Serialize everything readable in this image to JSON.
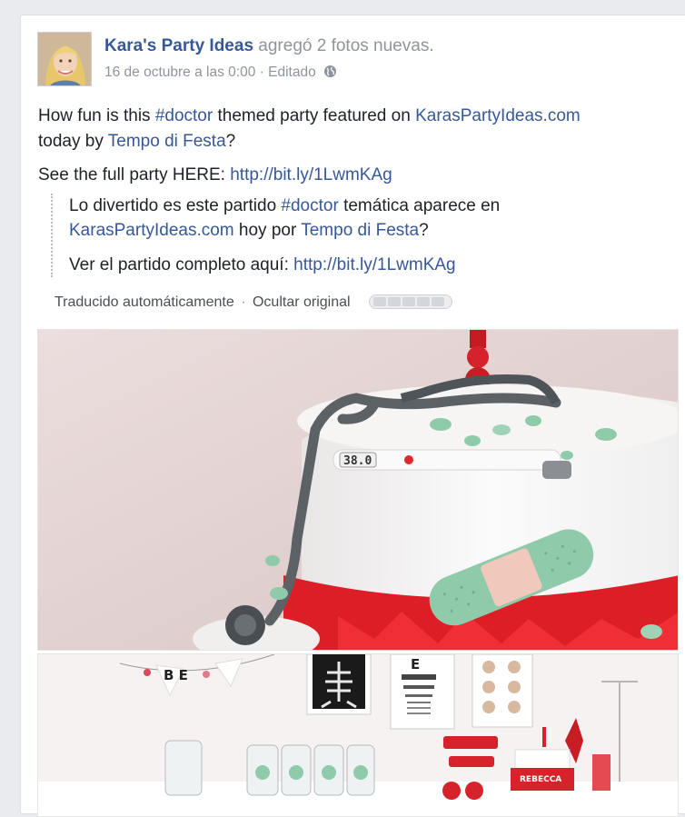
{
  "post": {
    "page_name": "Kara's Party Ideas",
    "action_text": "agregó 2 fotos nuevas.",
    "timestamp": "16 de octubre a las 0:00",
    "separator": "·",
    "edited_label": "Editado",
    "privacy_icon": "globe-icon",
    "menu_icon": "chevron-down-icon"
  },
  "body": {
    "line1_prefix": "How fun is this",
    "hashtag": "#doctor",
    "line1_middle": "themed party featured on",
    "site_link": "KarasPartyIdeas.com",
    "line1_today": "today by",
    "vendor_link": "Tempo di Festa",
    "question_mark": "?",
    "line2_prefix": "See the full party HERE:",
    "short_url": "http://bit.ly/1LwmKAg"
  },
  "translation": {
    "part1": "Lo divertido es este partido",
    "hashtag": "#doctor",
    "part2": "temática aparece en",
    "site_link": "KarasPartyIdeas.com",
    "part3": "hoy por",
    "vendor_link": "Tempo di Festa",
    "question_mark": "?",
    "line2_prefix": "Ver el partido completo aquí:",
    "short_url": "http://bit.ly/1LwmKAg",
    "auto_label": "Traducido automáticamente",
    "separator": "·",
    "hide_label": "Ocultar original",
    "rating_icon": "rate-translation-icon"
  },
  "photos": {
    "photo1_icon": "doctor-cake-photo",
    "photo2_icon": "party-table-photo",
    "thermometer_text": "38.0",
    "cake_name": "REBECCA",
    "banner_letters": "B E"
  },
  "colors": {
    "link": "#365899",
    "muted": "#90949c",
    "background": "#e9ebee"
  }
}
